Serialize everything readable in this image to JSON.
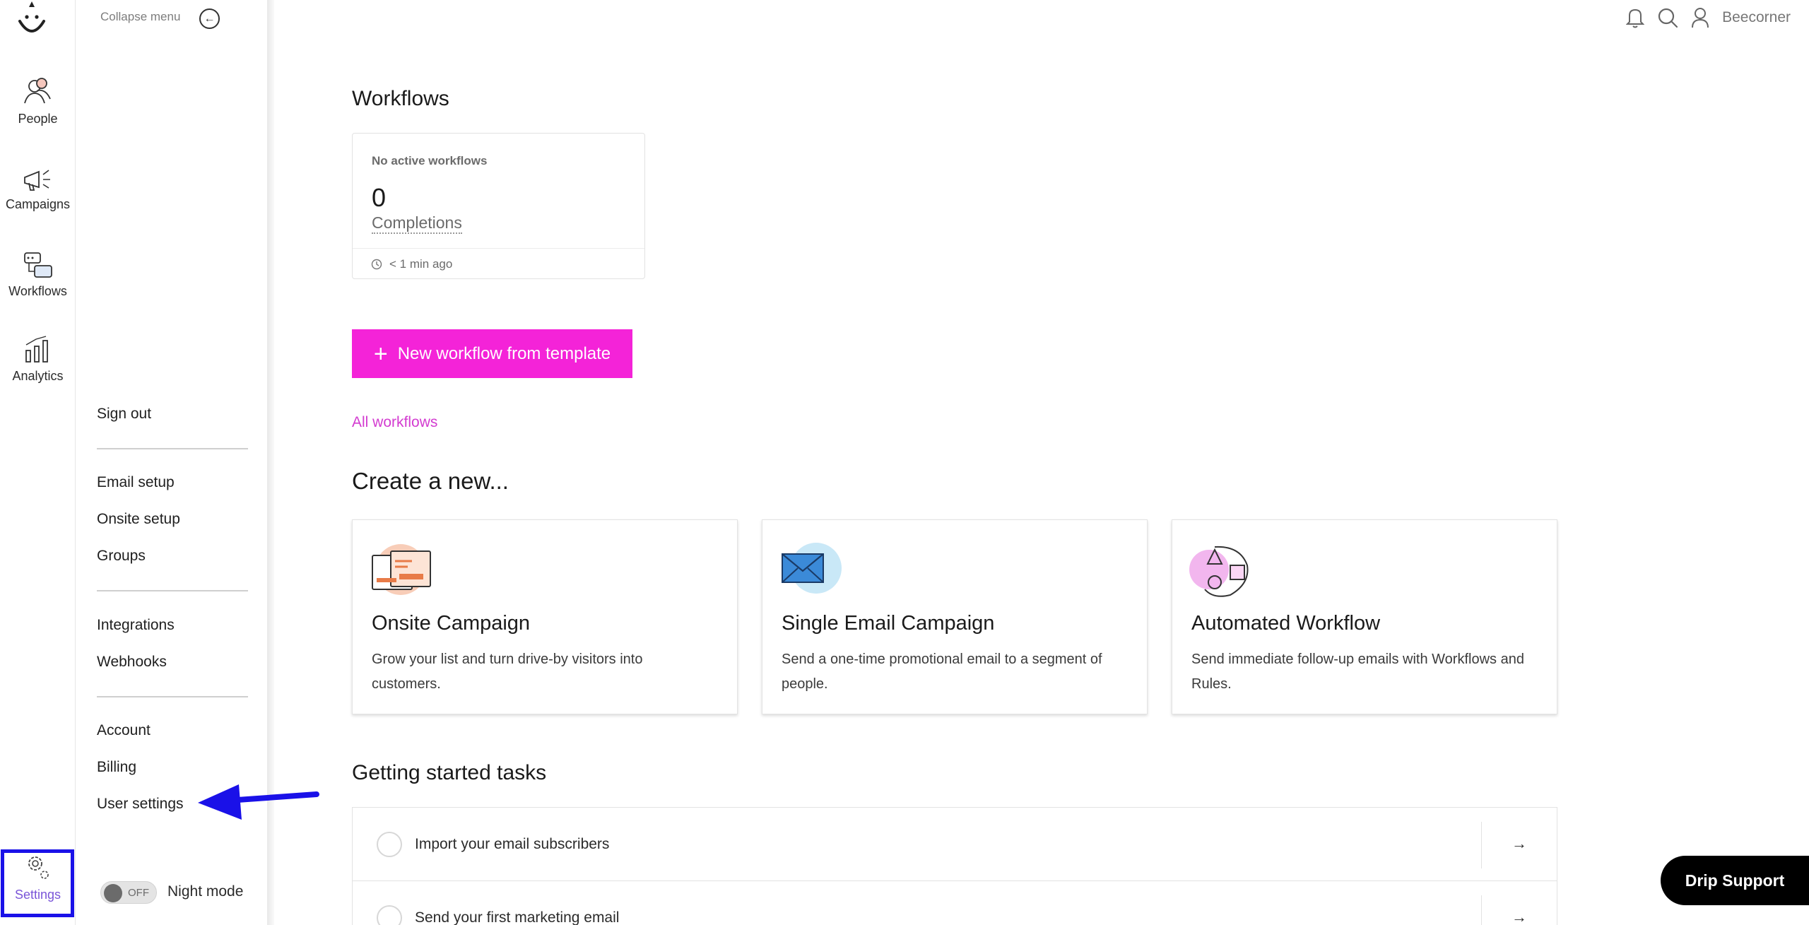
{
  "rail": {
    "items": [
      {
        "label": "People"
      },
      {
        "label": "Campaigns"
      },
      {
        "label": "Workflows"
      },
      {
        "label": "Analytics"
      }
    ],
    "settings_label": "Settings"
  },
  "menu": {
    "collapse_label": "Collapse menu",
    "sign_out": "Sign out",
    "email_setup": "Email setup",
    "onsite_setup": "Onsite setup",
    "groups": "Groups",
    "integrations": "Integrations",
    "webhooks": "Webhooks",
    "account": "Account",
    "billing": "Billing",
    "user_settings": "User settings",
    "toggle_state": "OFF",
    "night_mode": "Night mode"
  },
  "topbar": {
    "user_name": "Beecorner"
  },
  "workflows": {
    "heading": "Workflows",
    "card_status": "No active workflows",
    "count": "0",
    "count_label": "Completions",
    "updated": "< 1 min ago",
    "new_button": "New workflow from template",
    "all_link": "All workflows"
  },
  "create": {
    "heading": "Create a new...",
    "cards": [
      {
        "title": "Onsite Campaign",
        "desc": "Grow your list and turn drive-by visitors into customers."
      },
      {
        "title": "Single Email Campaign",
        "desc": "Send a one-time promotional email to a segment of people."
      },
      {
        "title": "Automated Workflow",
        "desc": "Send immediate follow-up emails with Workflows and Rules."
      }
    ]
  },
  "tasks": {
    "heading": "Getting started tasks",
    "items": [
      {
        "label": "Import your email subscribers"
      },
      {
        "label": "Send your first marketing email"
      }
    ]
  },
  "support_button": "Drip Support",
  "colors": {
    "primary": "#f423d8",
    "link": "#d33bd0",
    "highlight_box": "#1a11e8",
    "settings_active": "#7a55d8"
  }
}
